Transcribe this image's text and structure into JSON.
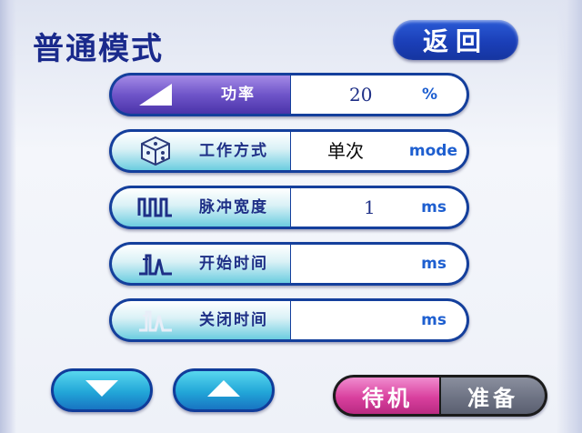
{
  "header": {
    "title": "普通模式",
    "back_label": "返回"
  },
  "rows": [
    {
      "label": "功率",
      "value": "20",
      "unit": "%"
    },
    {
      "label": "工作方式",
      "value": "单次",
      "unit": "mode"
    },
    {
      "label": "脉冲宽度",
      "value": "1",
      "unit": "ms"
    },
    {
      "label": "开始时间",
      "value": "",
      "unit": "ms"
    },
    {
      "label": "关闭时间",
      "value": "",
      "unit": "ms"
    }
  ],
  "icons": {
    "row_0": "ramp-icon",
    "row_1": "cube-icon",
    "row_2": "pulse-wave-icon",
    "row_3": "start-time-icon",
    "row_4": "stop-time-icon",
    "down": "arrow-down-icon",
    "up": "arrow-up-icon"
  },
  "footer": {
    "standby_label": "待机",
    "ready_label": "准备"
  },
  "colors": {
    "title": "#1a2a8c",
    "row_border": "#143f9c",
    "power_label": "#6f55c9",
    "standby": "#d9409e",
    "ready": "#6e7384"
  }
}
